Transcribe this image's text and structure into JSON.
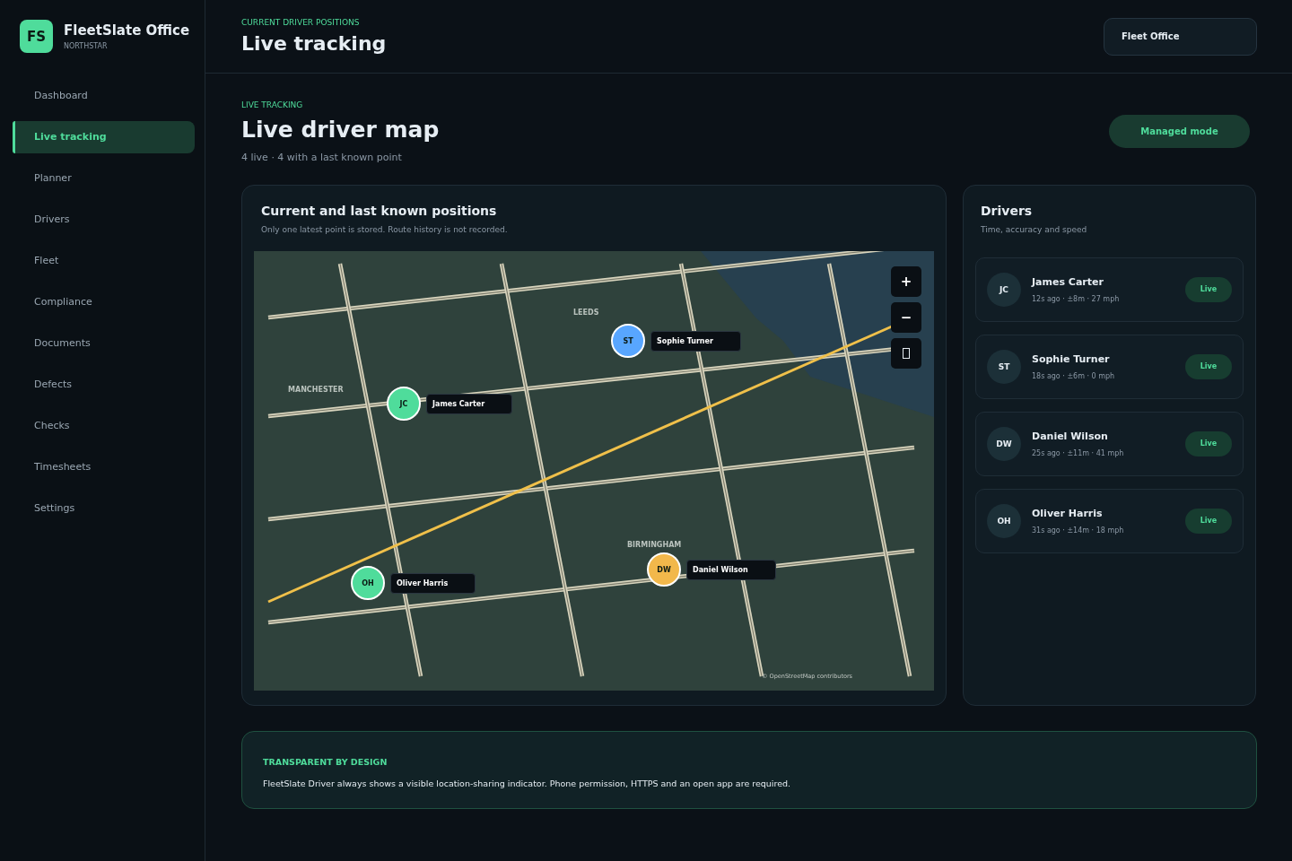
{
  "brand": {
    "logo": "FS",
    "name": "FleetSlate Office",
    "org": "NORTHSTAR"
  },
  "sidebar": {
    "items": [
      {
        "label": "Dashboard",
        "selected": false
      },
      {
        "label": "Live tracking",
        "selected": true
      },
      {
        "label": "Planner",
        "selected": false
      },
      {
        "label": "Drivers",
        "selected": false
      },
      {
        "label": "Fleet",
        "selected": false
      },
      {
        "label": "Compliance",
        "selected": false
      },
      {
        "label": "Documents",
        "selected": false
      },
      {
        "label": "Defects",
        "selected": false
      },
      {
        "label": "Checks",
        "selected": false
      },
      {
        "label": "Timesheets",
        "selected": false
      },
      {
        "label": "Settings",
        "selected": false
      }
    ]
  },
  "header": {
    "eyebrow": "CURRENT DRIVER POSITIONS",
    "title": "Live tracking",
    "account": "Fleet Office"
  },
  "page": {
    "eyebrow": "LIVE TRACKING",
    "title": "Live driver map",
    "summary": "4 live · 4 with a last known point",
    "mode": "Managed mode"
  },
  "map_card": {
    "title": "Current and last known positions",
    "subtitle": "Only one latest point is stored. Route history is not recorded.",
    "map": {
      "cities": [
        "LEEDS",
        "MANCHESTER",
        "BIRMINGHAM"
      ],
      "zoom_in": "+",
      "zoom_out": "−",
      "attribution": "© OpenStreetMap contributors",
      "markers": [
        {
          "initials": "JC",
          "name": "James Carter",
          "color": "#4fdc9b"
        },
        {
          "initials": "ST",
          "name": "Sophie Turner",
          "color": "#58a6ff"
        },
        {
          "initials": "DW",
          "name": "Daniel Wilson",
          "color": "#f2b84b"
        },
        {
          "initials": "OH",
          "name": "Oliver Harris",
          "color": "#4fdc9b"
        }
      ]
    }
  },
  "drivers_card": {
    "title": "Drivers",
    "subtitle": "Time, accuracy and speed",
    "drivers": [
      {
        "initials": "JC",
        "name": "James Carter",
        "meta": "12s ago · ±8m · 27 mph",
        "status": "Live"
      },
      {
        "initials": "ST",
        "name": "Sophie Turner",
        "meta": "18s ago · ±6m · 0 mph",
        "status": "Live"
      },
      {
        "initials": "DW",
        "name": "Daniel Wilson",
        "meta": "25s ago · ±11m · 41 mph",
        "status": "Live"
      },
      {
        "initials": "OH",
        "name": "Oliver Harris",
        "meta": "31s ago · ±14m · 18 mph",
        "status": "Live"
      }
    ]
  },
  "notice": {
    "title": "TRANSPARENT BY DESIGN",
    "text": "FleetSlate Driver always shows a visible location-sharing indicator. Phone permission, HTTPS and an open app are required."
  }
}
